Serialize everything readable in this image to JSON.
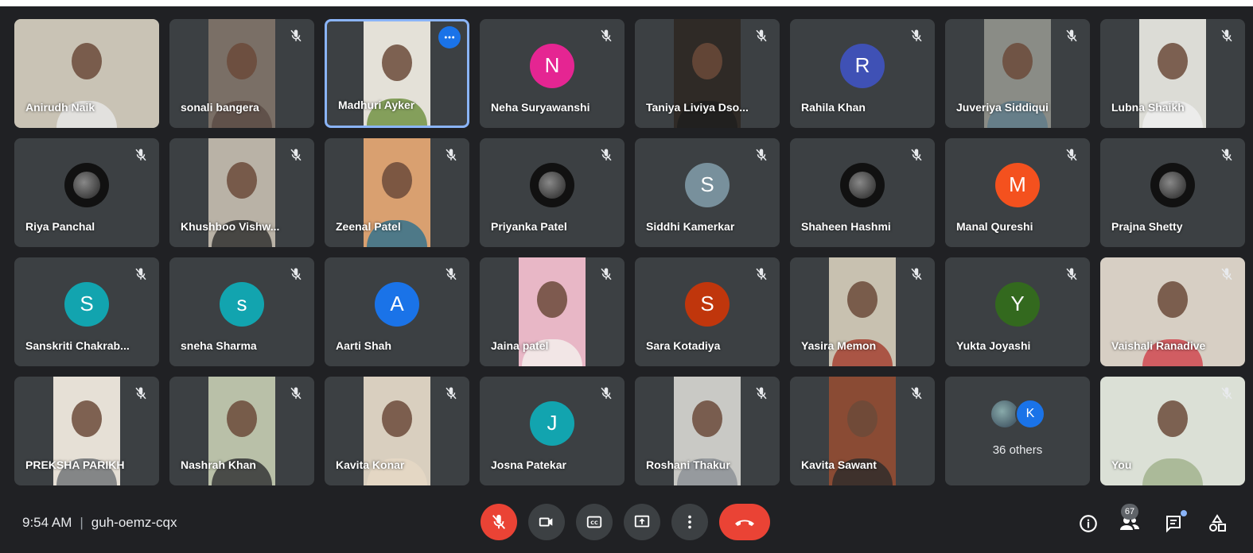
{
  "meeting": {
    "time": "9:54 AM",
    "code": "guh-oemz-cqx",
    "participant_count": "67",
    "others_label": "36 others",
    "others_initial": "K"
  },
  "colors": {
    "background": "#202124",
    "tile": "#3c4043",
    "accent": "#1a73e8",
    "danger": "#ea4335"
  },
  "participants": [
    {
      "name": "Anirudh Naik",
      "type": "video",
      "bg": "#c9c3b5",
      "shirt": "#e8e8e8",
      "muted": false,
      "full": true
    },
    {
      "name": "sonali bangera",
      "type": "video",
      "bg": "#7a6f66",
      "shirt": "#5a4a44",
      "muted": true
    },
    {
      "name": "Madhuri Ayker",
      "type": "video",
      "bg": "#e4e1d8",
      "shirt": "#6b8f3c",
      "muted": false,
      "active": true
    },
    {
      "name": "Neha Suryawanshi",
      "type": "initial",
      "initial": "N",
      "color": "#e52592",
      "muted": true
    },
    {
      "name": "Taniya Liviya Dso...",
      "type": "video",
      "bg": "#2f2a26",
      "shirt": "#1e1e1e",
      "muted": true
    },
    {
      "name": "Rahila Khan",
      "type": "initial",
      "initial": "R",
      "color": "#3f51b5",
      "muted": true
    },
    {
      "name": "Juveriya Siddiqui",
      "type": "video",
      "bg": "#8a8c86",
      "shirt": "#5d7b8a",
      "muted": true
    },
    {
      "name": "Lubna Shaikh",
      "type": "video",
      "bg": "#dcdcd6",
      "shirt": "#f0f0f0",
      "muted": true
    },
    {
      "name": "Riya Panchal",
      "type": "image",
      "muted": true
    },
    {
      "name": "Khushboo Vishw...",
      "type": "video",
      "bg": "#b9b2a6",
      "shirt": "#2b2b2b",
      "muted": true
    },
    {
      "name": "Zeenal Patel",
      "type": "video",
      "bg": "#d9a070",
      "shirt": "#2a6f8f",
      "muted": true
    },
    {
      "name": "Priyanka Patel",
      "type": "image",
      "muted": true
    },
    {
      "name": "Siddhi Kamerkar",
      "type": "initial",
      "initial": "S",
      "color": "#78909c",
      "muted": true
    },
    {
      "name": "Shaheen Hashmi",
      "type": "image",
      "muted": true
    },
    {
      "name": "Manal Qureshi",
      "type": "initial",
      "initial": "M",
      "color": "#f4511e",
      "muted": true
    },
    {
      "name": "Prajna Shetty",
      "type": "image",
      "muted": true
    },
    {
      "name": "Sanskriti Chakrab...",
      "type": "initial",
      "initial": "S",
      "color": "#12a4af",
      "muted": true
    },
    {
      "name": "sneha Sharma",
      "type": "initial",
      "initial": "s",
      "color": "#12a4af",
      "muted": true
    },
    {
      "name": "Aarti Shah",
      "type": "initial",
      "initial": "A",
      "color": "#1a73e8",
      "muted": true
    },
    {
      "name": "Jaina patel",
      "type": "video",
      "bg": "#e8b7c6",
      "shirt": "#f4f1ee",
      "muted": true
    },
    {
      "name": "Sara Kotadiya",
      "type": "initial",
      "initial": "S",
      "color": "#c0360c",
      "muted": true
    },
    {
      "name": "Yasira Memon",
      "type": "video",
      "bg": "#c8c1b0",
      "shirt": "#a33a2b",
      "muted": true
    },
    {
      "name": "Yukta Joyashi",
      "type": "initial",
      "initial": "Y",
      "color": "#33691e",
      "muted": true
    },
    {
      "name": "Vaishali Ranadive",
      "type": "video",
      "bg": "#d7cfc4",
      "shirt": "#d0404a",
      "muted": true,
      "full": true
    },
    {
      "name": "PREKSHA PARIKH",
      "type": "video",
      "bg": "#e6e0d6",
      "shirt": "#6c6f73",
      "muted": true
    },
    {
      "name": "Nashrah Khan",
      "type": "video",
      "bg": "#b9c0a8",
      "shirt": "#2d2d30",
      "muted": true
    },
    {
      "name": "Kavita Konar",
      "type": "video",
      "bg": "#d9cfbf",
      "shirt": "#e6d8c6",
      "muted": true
    },
    {
      "name": "Josna Patekar",
      "type": "initial",
      "initial": "J",
      "color": "#12a4af",
      "muted": true
    },
    {
      "name": "Roshani Thakur",
      "type": "video",
      "bg": "#c9c9c5",
      "shirt": "#8a8f93",
      "muted": true
    },
    {
      "name": "Kavita Sawant",
      "type": "video",
      "bg": "#8a4b34",
      "shirt": "#2a2a2a",
      "muted": true
    },
    {
      "name": "",
      "type": "others",
      "muted": false
    },
    {
      "name": "You",
      "type": "video",
      "bg": "#dbe0d6",
      "shirt": "#9fb08a",
      "muted": true,
      "full": true
    }
  ]
}
